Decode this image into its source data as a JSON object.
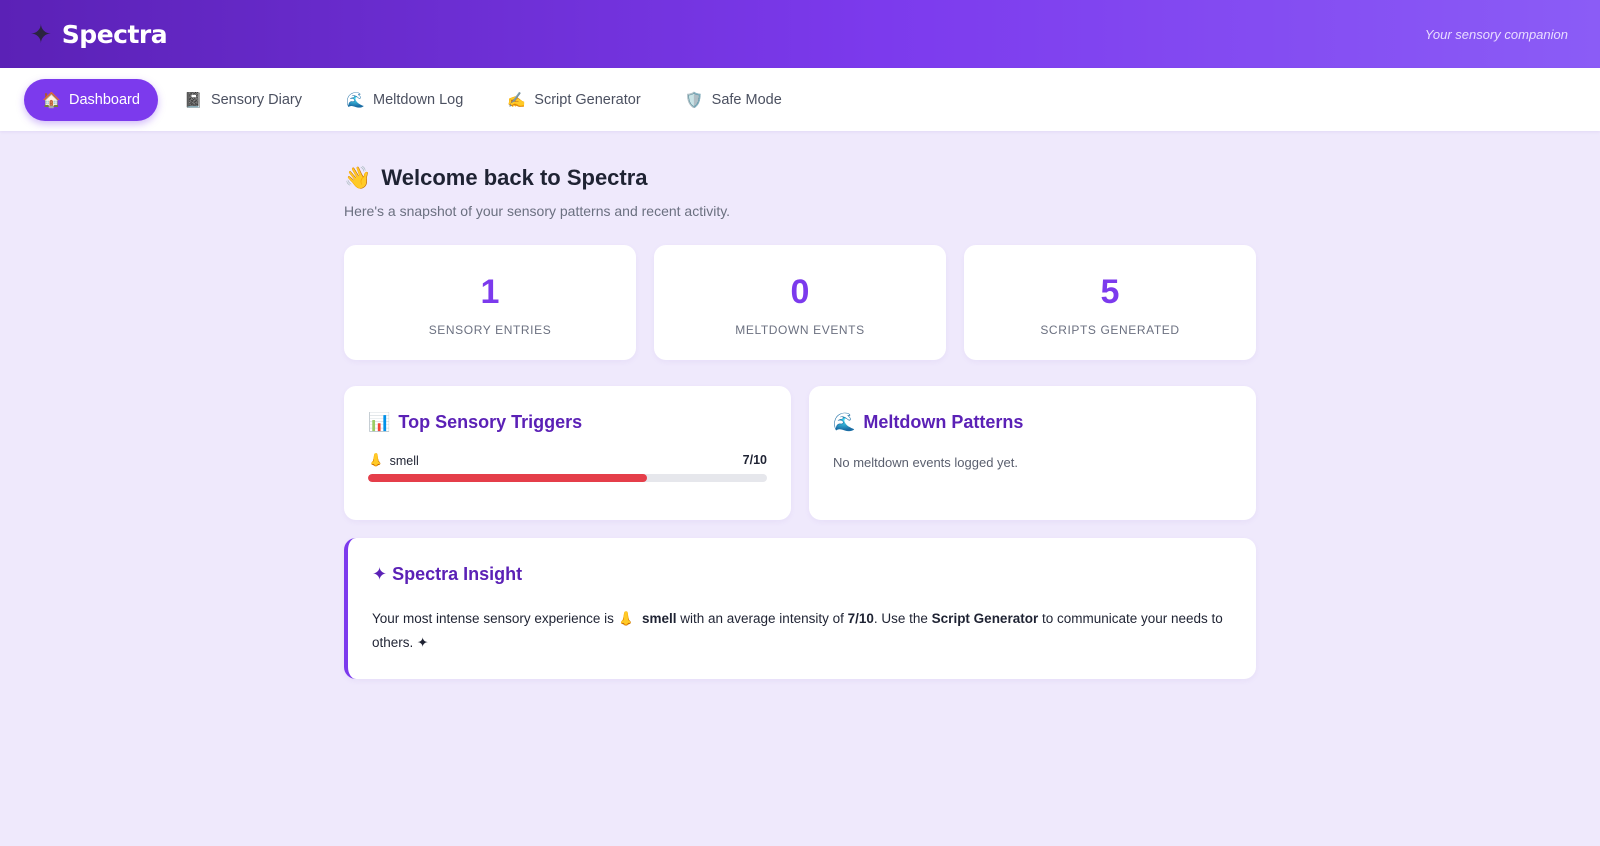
{
  "header": {
    "brand_icon": "✦",
    "brand_name": "Spectra",
    "tagline": "Your sensory companion"
  },
  "nav": [
    {
      "icon": "🏠",
      "icon_name": "house-icon",
      "label": "Dashboard",
      "active": true
    },
    {
      "icon": "📓",
      "icon_name": "notebook-icon",
      "label": "Sensory Diary",
      "active": false
    },
    {
      "icon": "🌊",
      "icon_name": "wave-icon",
      "label": "Meltdown Log",
      "active": false
    },
    {
      "icon": "✍️",
      "icon_name": "writing-hand-icon",
      "label": "Script Generator",
      "active": false
    },
    {
      "icon": "🛡️",
      "icon_name": "shield-icon",
      "label": "Safe Mode",
      "active": false
    }
  ],
  "welcome": {
    "icon": "👋",
    "title": "Welcome back to Spectra",
    "subtitle": "Here's a snapshot of your sensory patterns and recent activity."
  },
  "stats": [
    {
      "value": "1",
      "label": "SENSORY ENTRIES"
    },
    {
      "value": "0",
      "label": "MELTDOWN EVENTS"
    },
    {
      "value": "5",
      "label": "SCRIPTS GENERATED"
    }
  ],
  "triggers_card": {
    "icon": "📊",
    "title": "Top Sensory Triggers",
    "items": [
      {
        "icon": "👃",
        "name": "smell",
        "score_label": "7/10",
        "value": 7,
        "max": 10,
        "bar_color": "#e53e4a"
      }
    ]
  },
  "meltdown_card": {
    "icon": "🌊",
    "title": "Meltdown Patterns",
    "empty_text": "No meltdown events logged yet."
  },
  "insight": {
    "title": "✦ Spectra Insight",
    "text_1": "Your most intense sensory experience is ",
    "trigger_icon": "👃",
    "trigger_name": "smell",
    "text_2": " with an average intensity of ",
    "intensity": "7/10",
    "text_3": ". Use the ",
    "tool_name": "Script Generator",
    "text_4": " to communicate your needs to others. ✦"
  },
  "colors": {
    "accent": "#7c3aed",
    "accent_dark": "#5b21b6",
    "background": "#efe9fc",
    "bar_track": "#e6e7ec"
  }
}
